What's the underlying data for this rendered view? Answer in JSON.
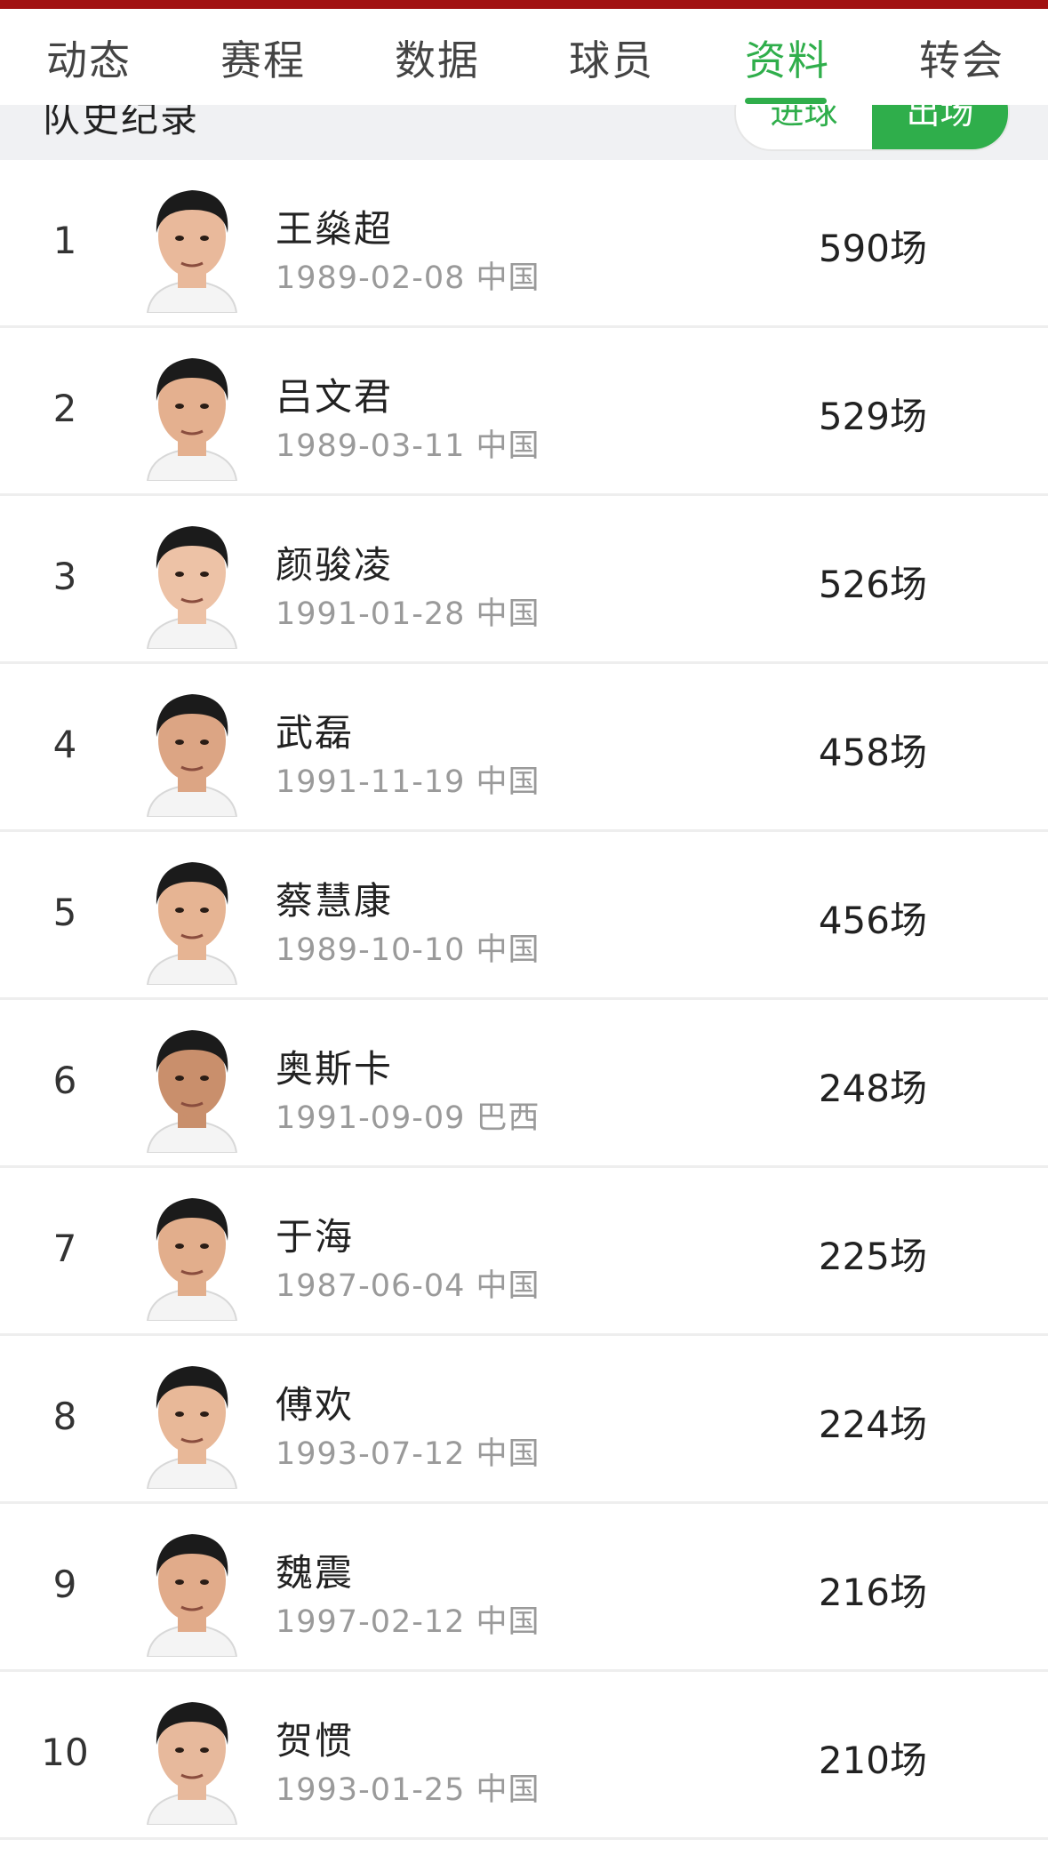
{
  "tabs": [
    {
      "label": "动态",
      "active": false
    },
    {
      "label": "赛程",
      "active": false
    },
    {
      "label": "数据",
      "active": false
    },
    {
      "label": "球员",
      "active": false
    },
    {
      "label": "资料",
      "active": true
    },
    {
      "label": "转会",
      "active": false
    }
  ],
  "section": {
    "title": "队史纪录",
    "toggle": {
      "left": "进球",
      "right": "出场"
    }
  },
  "colors": {
    "accent": "#2fae4b",
    "topbar": "#a11212"
  },
  "players": [
    {
      "rank": "1",
      "name": "王燊超",
      "birth": "1989-02-08",
      "country": "中国",
      "apps": "590场"
    },
    {
      "rank": "2",
      "name": "吕文君",
      "birth": "1989-03-11",
      "country": "中国",
      "apps": "529场"
    },
    {
      "rank": "3",
      "name": "颜骏凌",
      "birth": "1991-01-28",
      "country": "中国",
      "apps": "526场"
    },
    {
      "rank": "4",
      "name": "武磊",
      "birth": "1991-11-19",
      "country": "中国",
      "apps": "458场"
    },
    {
      "rank": "5",
      "name": "蔡慧康",
      "birth": "1989-10-10",
      "country": "中国",
      "apps": "456场"
    },
    {
      "rank": "6",
      "name": "奥斯卡",
      "birth": "1991-09-09",
      "country": "巴西",
      "apps": "248场"
    },
    {
      "rank": "7",
      "name": "于海",
      "birth": "1987-06-04",
      "country": "中国",
      "apps": "225场"
    },
    {
      "rank": "8",
      "name": "傅欢",
      "birth": "1993-07-12",
      "country": "中国",
      "apps": "224场"
    },
    {
      "rank": "9",
      "name": "魏震",
      "birth": "1997-02-12",
      "country": "中国",
      "apps": "216场"
    },
    {
      "rank": "10",
      "name": "贺惯",
      "birth": "1993-01-25",
      "country": "中国",
      "apps": "210场"
    }
  ]
}
